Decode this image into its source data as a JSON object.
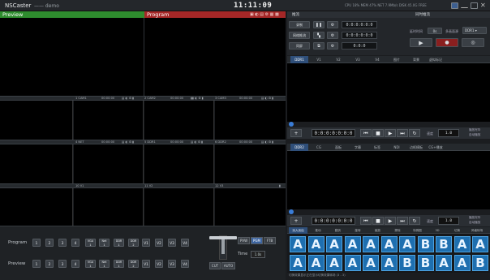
{
  "app": {
    "name": "NSCaster",
    "subtitle": "—— demo",
    "clock": "11:11:09",
    "sysinfo": "CPU 18%  MEM 47%  NET 7.9Mb/s  DISK 45.0G FREE"
  },
  "preview": {
    "label": "Preview"
  },
  "program": {
    "label": "Program"
  },
  "cells": {
    "row1": [
      {
        "name": "1 CAM1",
        "time": "00:00:00"
      },
      {
        "name": "2 CAM2",
        "time": "00:00:00"
      },
      {
        "name": "3 CAM3",
        "time": "00:00:00"
      }
    ],
    "row2": [
      {
        "name": "4 NET",
        "time": "00:00:00"
      },
      {
        "name": "5 DDR1",
        "time": "00:00:00"
      },
      {
        "name": "6 DDR2",
        "time": "00:00:00"
      }
    ],
    "row3": [
      {
        "name": "10 V1"
      },
      {
        "name": "11 V2"
      },
      {
        "name": "12 V3"
      }
    ]
  },
  "rec": {
    "header": "推流",
    "header2": "同时推流",
    "rows": [
      {
        "label": "录制",
        "timecode": "0:0:0:0:0:0"
      },
      {
        "label": "网络推流",
        "timecode": "0:0:0:0:0:0"
      },
      {
        "label": "同屏",
        "timecode": "0:0:0"
      }
    ],
    "right_label": "延时时间",
    "right_value": "0s",
    "right_label2": "多画面源",
    "right_select": "DDR1"
  },
  "ddr1": {
    "tabs": [
      "DDR1",
      "V1",
      "V2",
      "V3",
      "V4",
      "图片",
      "背景",
      "虚拟标记"
    ],
    "timecode": "0:0:0:0:0:0:0",
    "speed_label": "速度",
    "speed_value": "1.0",
    "side1": "播放完毕",
    "side2": "自动播放"
  },
  "ddr2": {
    "tabs": [
      "DDR2",
      "CG",
      "面板",
      "字幕",
      "标签",
      "NDI",
      "边框模板",
      "CG+播放"
    ],
    "timecode": "0:0:0:0:0:0:0",
    "speed_label": "速度",
    "speed_value": "1.0",
    "side1": "播放完毕",
    "side2": "自动播放"
  },
  "transitions": {
    "tabs": [
      "淡入淡出",
      "推动",
      "翻页",
      "旋转",
      "缩放",
      "擦除",
      "特殊图",
      "3D",
      "切换",
      "风格转场"
    ],
    "status": "切换效果显示正在显示切换效果转场 (3 - 3)",
    "row1": [
      "A",
      "A",
      "A",
      "A",
      "A",
      "A",
      "A",
      "B",
      "B",
      "A",
      "A"
    ],
    "row2": [
      "A",
      "A",
      "A",
      "A",
      "A",
      "A",
      "B",
      "B",
      "A",
      "A",
      "B"
    ]
  },
  "switcher": {
    "program_label": "Program",
    "preview_label": "Preview",
    "buttons": [
      {
        "l1": "1"
      },
      {
        "l1": "2"
      },
      {
        "l1": "3"
      },
      {
        "l1": "4"
      },
      {
        "l1": "VGA",
        "l2": "1"
      },
      {
        "l1": "Net",
        "l2": "1"
      },
      {
        "l1": "DDR",
        "l2": "1"
      },
      {
        "l1": "DDR",
        "l2": "2"
      },
      {
        "l1": "V1"
      },
      {
        "l1": "V2"
      },
      {
        "l1": "V3"
      },
      {
        "l1": "V4"
      }
    ],
    "modes": [
      "PVW",
      "PGM",
      "FTB"
    ],
    "active_mode": "PGM",
    "time_label": "Time",
    "time_value": "1.0s",
    "cut": "CUT",
    "auto": "AUTO"
  }
}
